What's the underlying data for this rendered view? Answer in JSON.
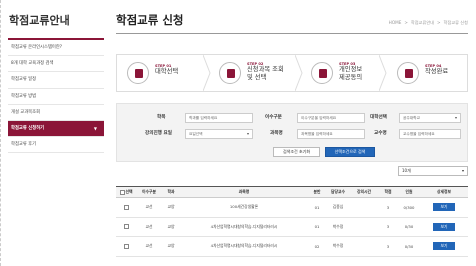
{
  "sidebar": {
    "title": "학점교류안내",
    "items": [
      {
        "label": "학점교류 온라인시스템이란?"
      },
      {
        "label": "8개 대학 교육과정 검색"
      },
      {
        "label": "학점교류 일정"
      },
      {
        "label": "학점교류 방법"
      },
      {
        "label": "개설 교과목조회"
      },
      {
        "label": "학점교류 신청하기",
        "arrow": "▼"
      },
      {
        "label": "학점교류 후기"
      }
    ]
  },
  "header": {
    "title": "학점교류 신청",
    "breadcrumb": [
      "HOME",
      "학점교류안내",
      "학점교류 신청"
    ],
    "breadcrumb_sep": ">"
  },
  "steps": [
    {
      "no": "STEP 01",
      "name": "대학선택"
    },
    {
      "no": "STEP 02",
      "name": "신청과목 조회\n및 선택"
    },
    {
      "no": "STEP 03",
      "name": "개인정보\n제공동의"
    },
    {
      "no": "STEP 04",
      "name": "작성완료"
    }
  ],
  "form": {
    "course_label": "학목",
    "course_placeholder": "학과를 입력하세요",
    "dept_label": "이수구분",
    "dept_placeholder": "이수구분을 입력하세요",
    "univ_label": "대학선택",
    "univ_value": "공주대학교",
    "dayof_label": "강의진행 요일",
    "dayof_value": "요일선택",
    "subject_label": "과목명",
    "subject_placeholder": "과목명을 입력하세요",
    "prof_label": "교수명",
    "prof_placeholder": "교수명을 입력하세요",
    "reset_label": "검색조건 초기화",
    "search_label": "선택조건으로 검색"
  },
  "per_page": "10개",
  "table": {
    "columns": [
      "선택",
      "이수구분",
      "학과",
      "과목명",
      "분반",
      "담당교수",
      "강의시간",
      "학점",
      "인원",
      "상세정보"
    ],
    "rows": [
      {
        "type": "교선",
        "dept": "교양",
        "course": "100세건강생활론",
        "section": "01",
        "prof": "김종심",
        "time": "",
        "credit": "3",
        "seats": "0/300",
        "action": "보기"
      },
      {
        "type": "교선",
        "dept": "교양",
        "course": "4차산업혁명시대창의학습-디지털리터러시",
        "section": "01",
        "prof": "박수정",
        "time": "",
        "credit": "3",
        "seats": "0/30",
        "action": "보기"
      },
      {
        "type": "교선",
        "dept": "교양",
        "course": "4차산업혁명시대창의학습-디지털리터러시",
        "section": "02",
        "prof": "박수정",
        "time": "",
        "credit": "3",
        "seats": "0/30",
        "action": "보기"
      }
    ]
  },
  "colors": {
    "accent": "#8b1538",
    "primary_button": "#2266b8"
  }
}
